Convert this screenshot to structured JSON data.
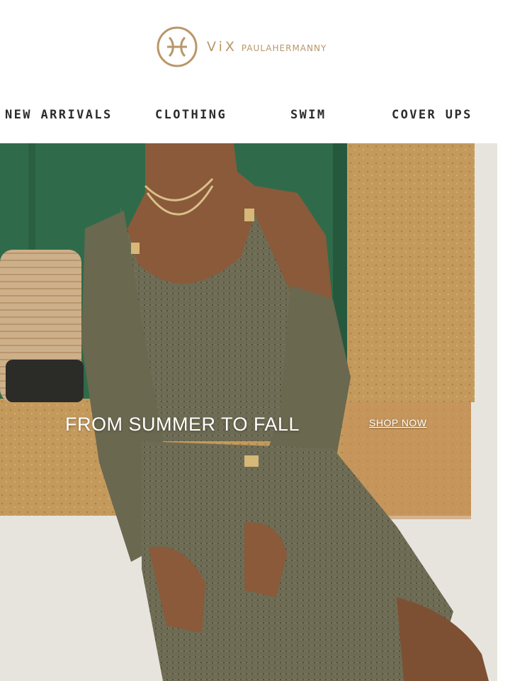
{
  "brand": {
    "name_vix": "ViX",
    "name_sub": "PAULAHERMANNY",
    "color": "#b8976a",
    "logo_icon": "vix-monogram-icon"
  },
  "nav": {
    "items": [
      {
        "label": "NEW ARRIVALS"
      },
      {
        "label": "CLOTHING"
      },
      {
        "label": "SWIM"
      },
      {
        "label": "COVER UPS"
      }
    ]
  },
  "hero": {
    "title": "FROM SUMMER TO FALL",
    "cta": "SHOP NOW",
    "palette": {
      "door_green": "#2f6b4a",
      "stone": "#c79a5a",
      "wall": "#e7e4de",
      "knit": "#6c6a52",
      "skin": "#8a5a3a"
    }
  }
}
